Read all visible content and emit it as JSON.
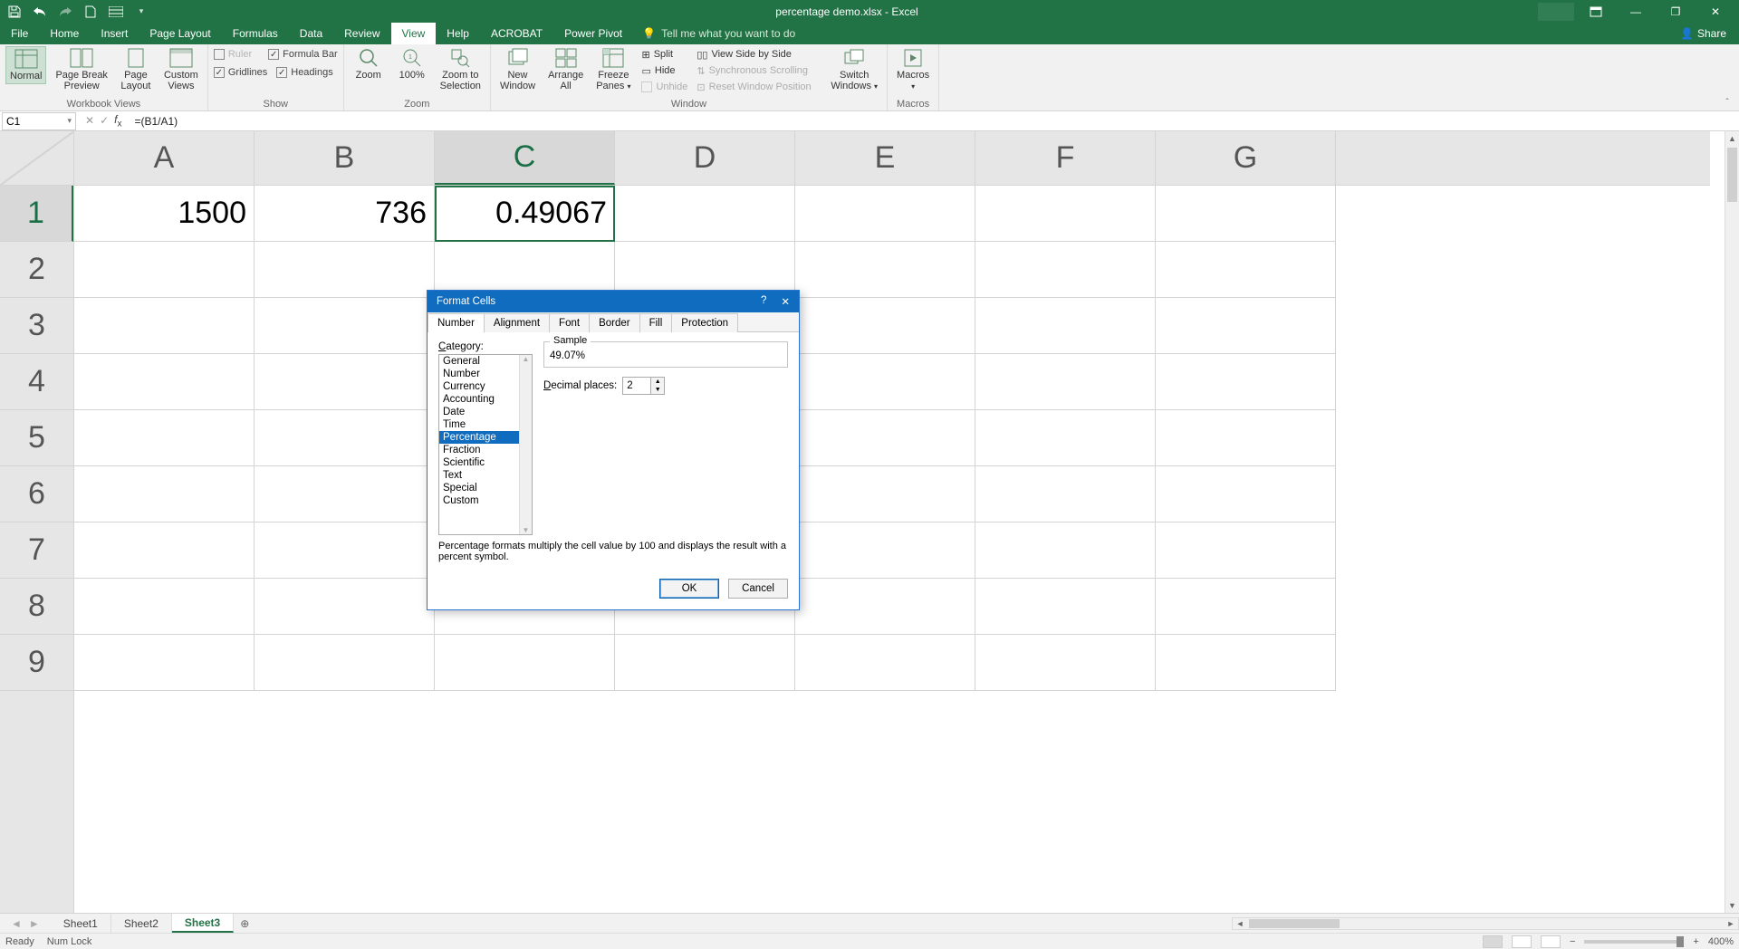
{
  "title": "percentage demo.xlsx  -  Excel",
  "qa": {
    "save": "save",
    "undo": "undo",
    "redo": "redo",
    "new": "new",
    "xdform": "xdform",
    "more": "more"
  },
  "tabs": [
    "File",
    "Home",
    "Insert",
    "Page Layout",
    "Formulas",
    "Data",
    "Review",
    "View",
    "Help",
    "ACROBAT",
    "Power Pivot"
  ],
  "active_tab": "View",
  "tellme": "Tell me what you want to do",
  "share": "Share",
  "ribbon": {
    "workbook_views": {
      "label": "Workbook Views",
      "normal": "Normal",
      "pagebreak": "Page Break\nPreview",
      "pagelayout": "Page\nLayout",
      "custom": "Custom\nViews"
    },
    "show": {
      "label": "Show",
      "ruler": "Ruler",
      "formulabar": "Formula Bar",
      "gridlines": "Gridlines",
      "headings": "Headings"
    },
    "zoom": {
      "label": "Zoom",
      "zoom": "Zoom",
      "hundred": "100%",
      "selection": "Zoom to\nSelection"
    },
    "window": {
      "label": "Window",
      "newwin": "New\nWindow",
      "arrange": "Arrange\nAll",
      "freeze": "Freeze\nPanes",
      "split": "Split",
      "hide": "Hide",
      "unhide": "Unhide",
      "sidebyside": "View Side by Side",
      "syncscroll": "Synchronous Scrolling",
      "resetpos": "Reset Window Position",
      "switch": "Switch\nWindows"
    },
    "macros": {
      "label": "Macros",
      "macros": "Macros"
    }
  },
  "namebox": "C1",
  "formula": "=(B1/A1)",
  "columns": [
    "A",
    "B",
    "C",
    "D",
    "E",
    "F",
    "G"
  ],
  "sel_col_index": 2,
  "rows": [
    1,
    2,
    3,
    4,
    5,
    6,
    7,
    8,
    9
  ],
  "sel_row_index": 0,
  "cells": {
    "r0c0": "1500",
    "r0c1": "736",
    "r0c2": "0.49067"
  },
  "sheets": [
    "Sheet1",
    "Sheet2",
    "Sheet3"
  ],
  "active_sheet": 2,
  "status": {
    "ready": "Ready",
    "numlock": "Num Lock",
    "zoom": "400%"
  },
  "dialog": {
    "title": "Format Cells",
    "tabs": [
      "Number",
      "Alignment",
      "Font",
      "Border",
      "Fill",
      "Protection"
    ],
    "active_tab": 0,
    "category_label": "Category:",
    "categories": [
      "General",
      "Number",
      "Currency",
      "Accounting",
      "Date",
      "Time",
      "Percentage",
      "Fraction",
      "Scientific",
      "Text",
      "Special",
      "Custom"
    ],
    "selected_category": 6,
    "sample_label": "Sample",
    "sample_value": "49.07%",
    "decimal_label": "Decimal places:",
    "decimal_value": "2",
    "description": "Percentage formats multiply the cell value by 100 and displays the result with a percent symbol.",
    "ok": "OK",
    "cancel": "Cancel"
  },
  "win": {
    "min": "—",
    "max": "▭",
    "close": "✕",
    "restore": "❐",
    "ribbon_opts": "▾"
  }
}
